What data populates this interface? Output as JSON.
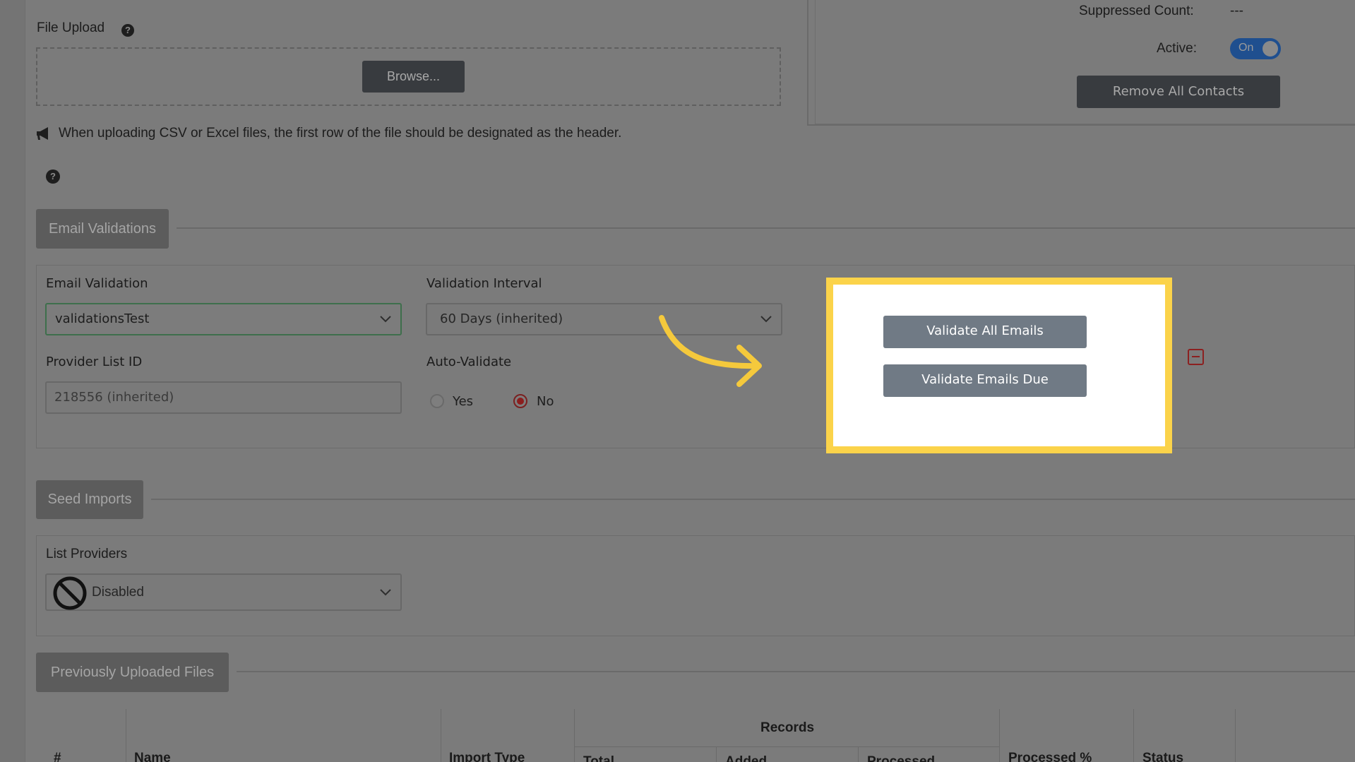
{
  "file_upload": {
    "label": "File Upload",
    "browse_label": "Browse...",
    "notice": "When uploading CSV or Excel files, the first row of the file should be designated as the header."
  },
  "right_panel": {
    "suppressed_label": "Suppressed Count:",
    "suppressed_value": "---",
    "active_label": "Active:",
    "active_toggle": "On",
    "remove_button": "Remove All Contacts"
  },
  "email_validations": {
    "section_title": "Email Validations",
    "email_validation_label": "Email Validation",
    "email_validation_value": "validationsTest",
    "validation_interval_label": "Validation Interval",
    "validation_interval_value": "60 Days (inherited)",
    "provider_list_id_label": "Provider List ID",
    "provider_list_id_value": "218556 (inherited)",
    "auto_validate_label": "Auto-Validate",
    "auto_validate_yes": "Yes",
    "auto_validate_no": "No",
    "auto_validate_selected": "No",
    "validate_all_button": "Validate All Emails",
    "validate_due_button": "Validate Emails Due"
  },
  "seed_imports": {
    "section_title": "Seed Imports",
    "list_providers_label": "List Providers",
    "list_providers_value": "Disabled"
  },
  "previously_uploaded": {
    "section_title": "Previously Uploaded Files",
    "columns": {
      "num": "#",
      "name": "Name",
      "import_type": "Import Type",
      "records": "Records",
      "total": "Total",
      "added": "Added",
      "processed": "Processed",
      "processed_pct": "Processed %",
      "status": "Status"
    }
  },
  "colors": {
    "highlight_border": "#fbd34a",
    "arrow": "#f5c93c",
    "toggle_on": "#1f4f8f",
    "validate_button": "#707a85",
    "radio_selected": "#8c1e1e"
  }
}
